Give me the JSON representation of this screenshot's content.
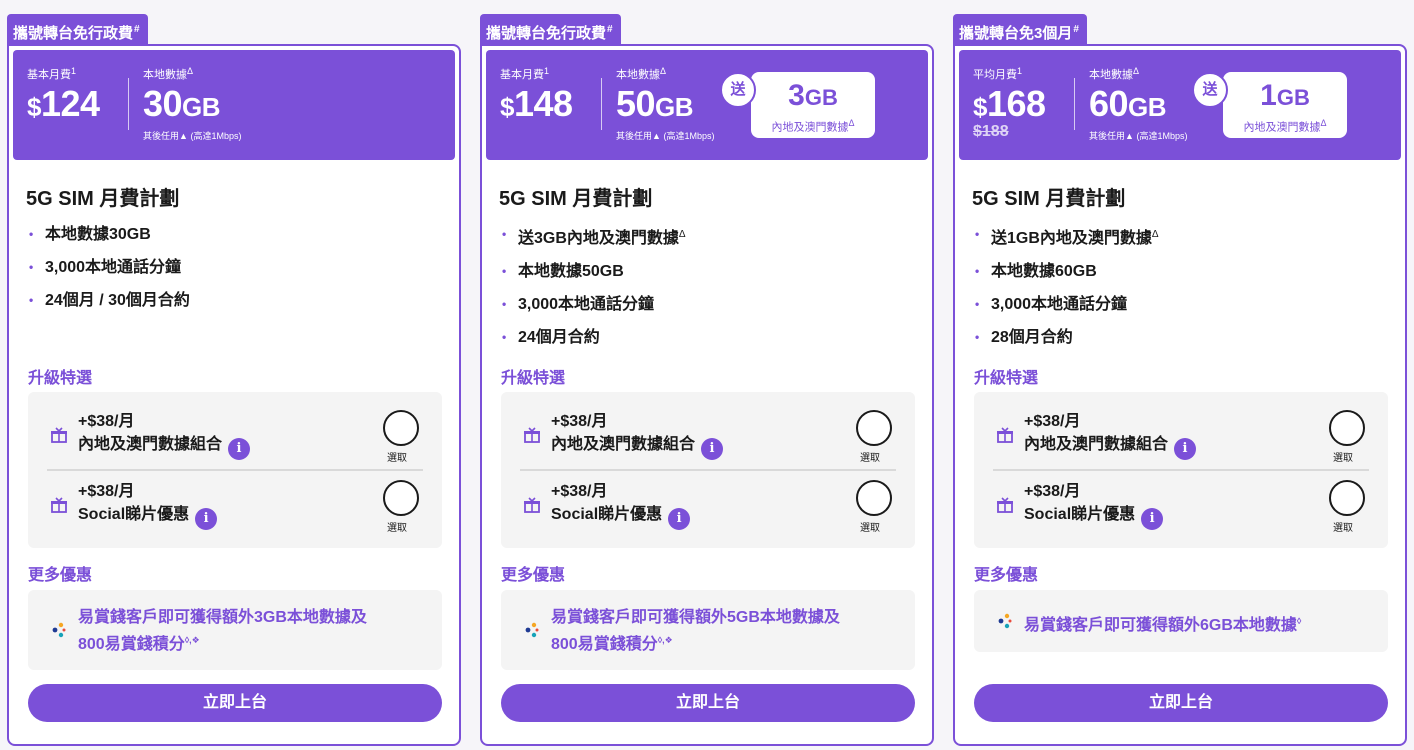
{
  "plans": [
    {
      "tag": "攜號轉台免行政費",
      "tag_sup": "#",
      "price_label": "基本月費",
      "price_sup": "1",
      "price_currency": "$",
      "price": "124",
      "old_price": "",
      "data_label": "本地數據",
      "data_sup": "Δ",
      "data_value": "30",
      "data_unit": "GB",
      "subnote": "其後任用",
      "subnote_paren": "(高達1Mbps)",
      "bonus": null,
      "title": "5G SIM 月費計劃",
      "features": [
        {
          "text": "本地數據30GB",
          "sup": ""
        },
        {
          "text": "3,000本地通話分鐘",
          "sup": ""
        },
        {
          "text": "24個月 / 30個月合約",
          "sup": ""
        }
      ],
      "upgrade_label": "升級特選",
      "addons": [
        {
          "price": "+$38/月",
          "name": "內地及澳門數據組合",
          "info": "i",
          "select": "選取"
        },
        {
          "price": "+$38/月",
          "name": "Social睇片優惠",
          "info": "i",
          "select": "選取"
        }
      ],
      "more_label": "更多優惠",
      "offer_line1": "易賞錢客戶即可獲得額外3GB本地數據及",
      "offer_line2": "800易賞錢積分",
      "offer_sup": "◊,❖",
      "cta": "立即上台"
    },
    {
      "tag": "攜號轉台免行政費",
      "tag_sup": "#",
      "price_label": "基本月費",
      "price_sup": "1",
      "price_currency": "$",
      "price": "148",
      "old_price": "",
      "data_label": "本地數據",
      "data_sup": "Δ",
      "data_value": "50",
      "data_unit": "GB",
      "subnote": "其後任用",
      "subnote_paren": "(高達1Mbps)",
      "bonus": {
        "badge": "送",
        "value": "3",
        "unit": "GB",
        "desc": "內地及澳門數據",
        "desc_sup": "Δ"
      },
      "title": "5G SIM 月費計劃",
      "features": [
        {
          "text": "送3GB內地及澳門數據",
          "sup": "Δ"
        },
        {
          "text": "本地數據50GB",
          "sup": ""
        },
        {
          "text": "3,000本地通話分鐘",
          "sup": ""
        },
        {
          "text": "24個月合約",
          "sup": ""
        }
      ],
      "upgrade_label": "升級特選",
      "addons": [
        {
          "price": "+$38/月",
          "name": "內地及澳門數據組合",
          "info": "i",
          "select": "選取"
        },
        {
          "price": "+$38/月",
          "name": "Social睇片優惠",
          "info": "i",
          "select": "選取"
        }
      ],
      "more_label": "更多優惠",
      "offer_line1": "易賞錢客戶即可獲得額外5GB本地數據及",
      "offer_line2": "800易賞錢積分",
      "offer_sup": "◊,❖",
      "cta": "立即上台"
    },
    {
      "tag": "攜號轉台免3個月",
      "tag_sup": "#",
      "price_label": "平均月費",
      "price_sup": "1",
      "price_currency": "$",
      "price": "168",
      "old_price": "$188",
      "data_label": "本地數據",
      "data_sup": "Δ",
      "data_value": "60",
      "data_unit": "GB",
      "subnote": "其後任用",
      "subnote_paren": "(高達1Mbps)",
      "bonus": {
        "badge": "送",
        "value": "1",
        "unit": "GB",
        "desc": "內地及澳門數據",
        "desc_sup": "Δ"
      },
      "title": "5G SIM 月費計劃",
      "features": [
        {
          "text": "送1GB內地及澳門數據",
          "sup": "Δ"
        },
        {
          "text": "本地數據60GB",
          "sup": ""
        },
        {
          "text": "3,000本地通話分鐘",
          "sup": ""
        },
        {
          "text": "28個月合約",
          "sup": ""
        }
      ],
      "upgrade_label": "升級特選",
      "addons": [
        {
          "price": "+$38/月",
          "name": "內地及澳門數據組合",
          "info": "i",
          "select": "選取"
        },
        {
          "price": "+$38/月",
          "name": "Social睇片優惠",
          "info": "i",
          "select": "選取"
        }
      ],
      "more_label": "更多優惠",
      "offer_line1": "易賞錢客戶即可獲得額外6GB本地數據",
      "offer_line2": "",
      "offer_sup": "◊",
      "cta": "立即上台"
    }
  ],
  "colors": {
    "brand_purple": "#7b50d8",
    "panel_grey": "#f4f4f4"
  }
}
